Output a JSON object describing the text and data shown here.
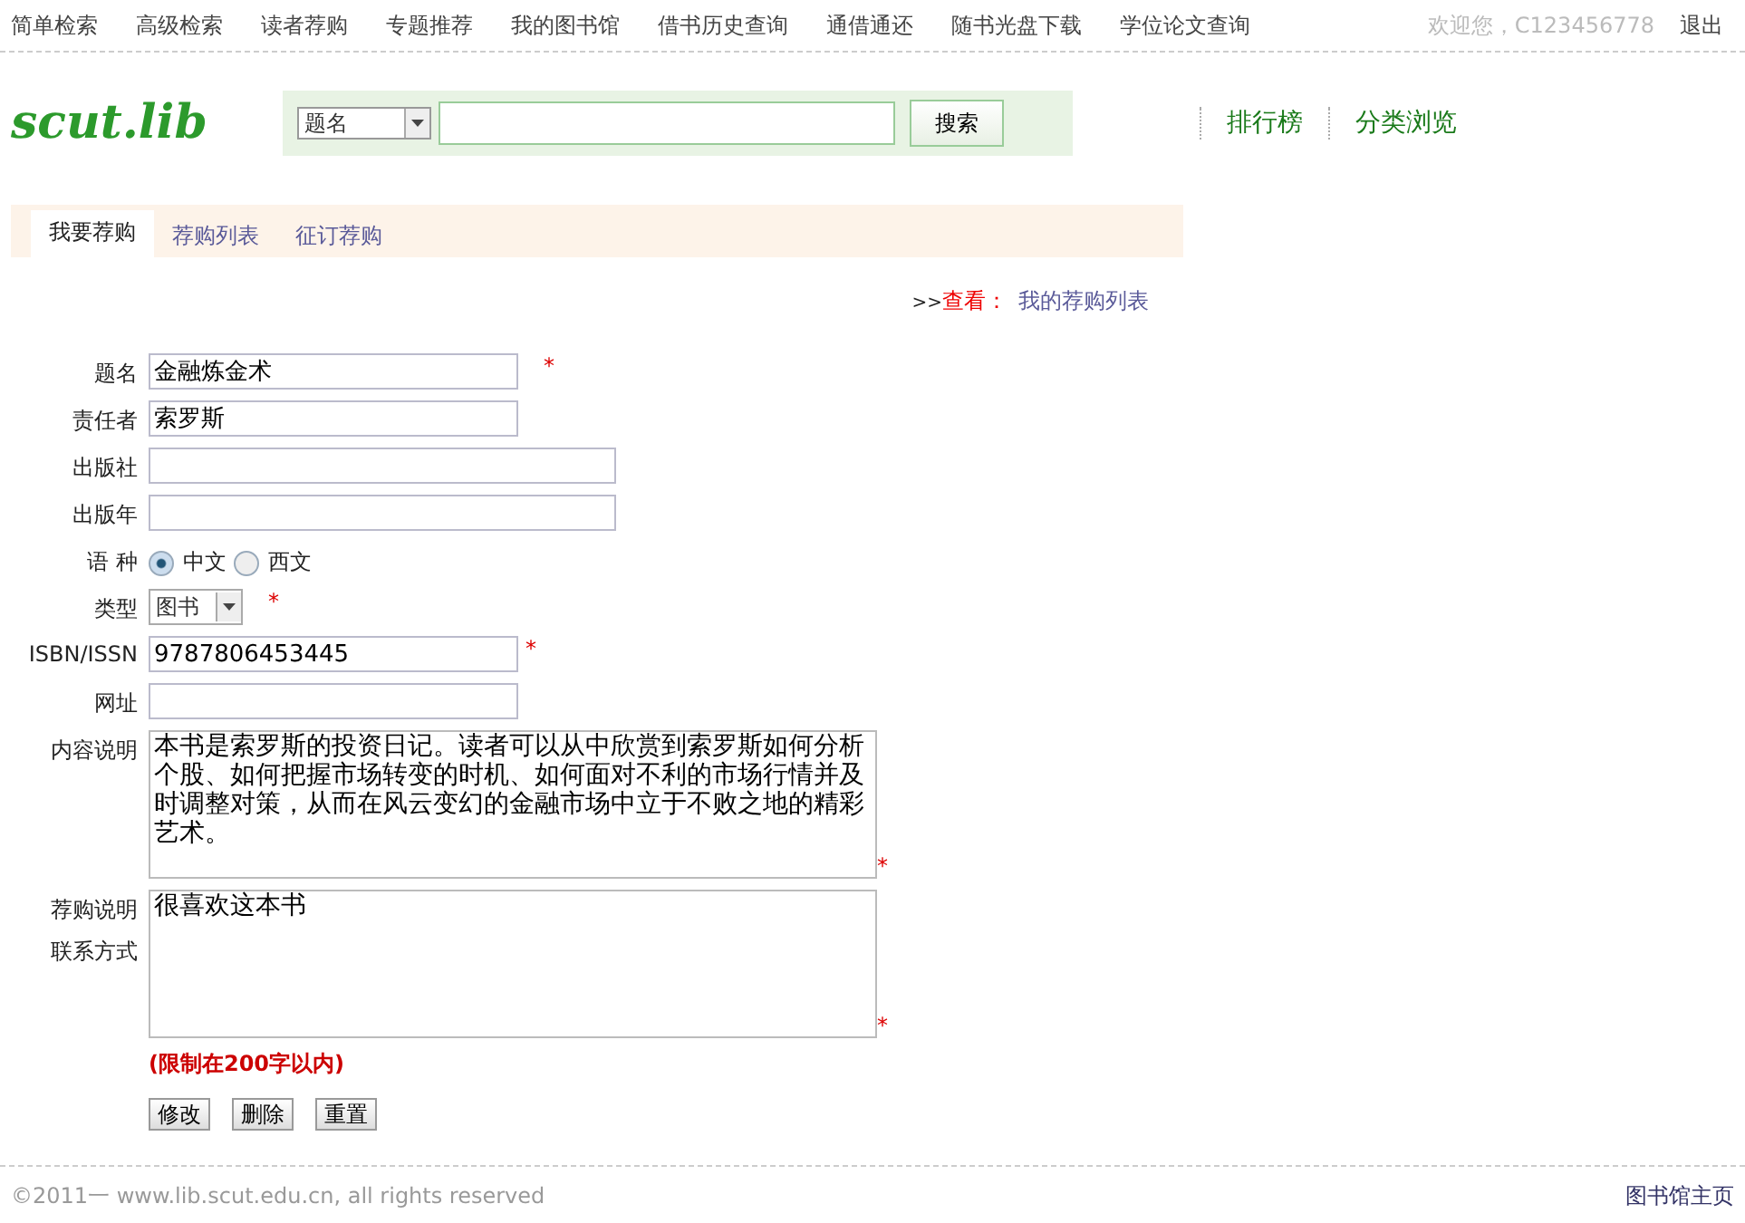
{
  "top_nav": {
    "links": [
      "简单检索",
      "高级检索",
      "读者荐购",
      "专题推荐",
      "我的图书馆",
      "借书历史查询",
      "通借通还",
      "随书光盘下载",
      "学位论文查询"
    ],
    "welcome": "欢迎您，C123456778",
    "logout": "退出"
  },
  "header": {
    "logo": "scut.lib",
    "search": {
      "scope": "题名",
      "button": "搜索"
    },
    "links": [
      "排行榜",
      "分类浏览"
    ]
  },
  "tabs": [
    {
      "label": "我要荐购",
      "selected": true
    },
    {
      "label": "荐购列表",
      "selected": false
    },
    {
      "label": "征订荐购",
      "selected": false
    }
  ],
  "view_link": {
    "prefix": ">>",
    "label": "查看：",
    "link": "我的荐购列表"
  },
  "form": {
    "fields": [
      {
        "kind": "text",
        "labels": [
          "题名"
        ],
        "value": "金融炼金术",
        "mark": "*"
      },
      {
        "kind": "text",
        "labels": [
          "责任者"
        ],
        "value": "索罗斯"
      },
      {
        "kind": "text",
        "labels": [
          "出版社"
        ]
      },
      {
        "kind": "text",
        "labels": [
          "出版年"
        ]
      },
      {
        "kind": "radio",
        "labels": [
          "语 种"
        ],
        "options": [
          {
            "label": "中文",
            "selected": true
          },
          {
            "label": "西文",
            "selected": false
          }
        ]
      },
      {
        "kind": "select",
        "labels": [
          "类型"
        ],
        "value": "图书",
        "mark": "*"
      },
      {
        "kind": "text",
        "labels": [
          "ISBN/ISSN"
        ],
        "value": "9787806453445",
        "mark": "*"
      },
      {
        "kind": "text",
        "labels": [
          "网址"
        ]
      },
      {
        "kind": "textarea",
        "labels": [
          "内容说明"
        ],
        "value": "本书是索罗斯的投资日记。读者可以从中欣赏到索罗斯如何分析个股、如何把握市场转变的时机、如何面对不利的市场行情并及时调整对策，从而在风云变幻的金融市场中立于不败之地的精彩艺术。",
        "mark": "*"
      },
      {
        "kind": "textarea",
        "labels": [
          "荐购说明",
          "联系方式"
        ],
        "value": "很喜欢这本书",
        "mark": "*"
      }
    ],
    "note": "(限制在200字以内)",
    "buttons": [
      "修改",
      "删除",
      "重置"
    ]
  },
  "footer": {
    "copyright": "©2011一 www.lib.scut.edu.cn, all rights reserved",
    "home_link": "图书馆主页"
  }
}
